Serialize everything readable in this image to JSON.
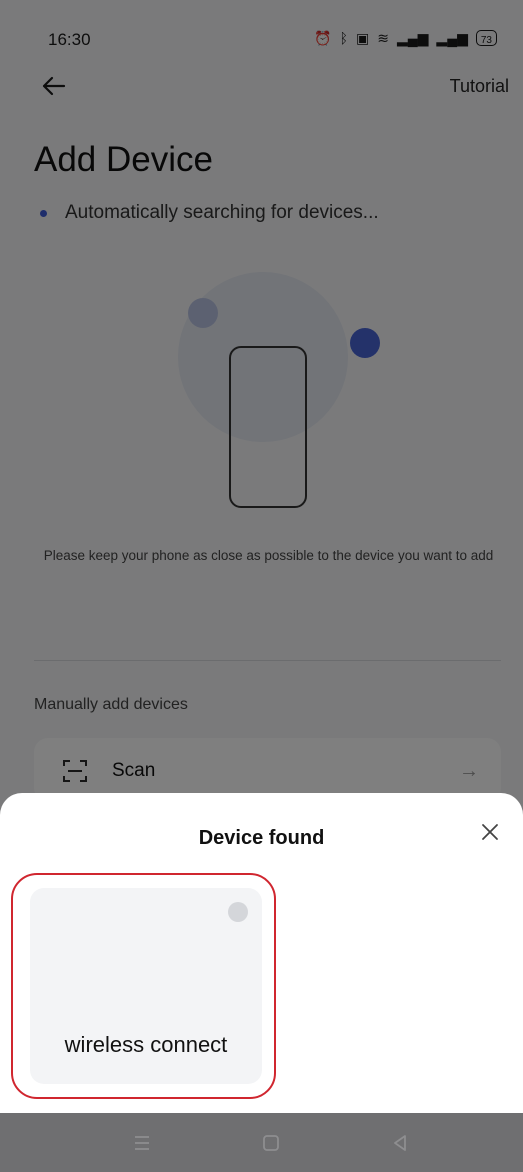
{
  "status_bar": {
    "time": "16:30",
    "battery": "73"
  },
  "header": {
    "tutorial_label": "Tutorial"
  },
  "page": {
    "title": "Add Device",
    "searching_text": "Automatically searching for devices...",
    "hint_text": "Please keep your phone as close as possible to the device you want to add",
    "manual_section_label": "Manually add devices",
    "scan_label": "Scan"
  },
  "sheet": {
    "title": "Device found",
    "devices": [
      {
        "label": "wireless connect"
      }
    ]
  },
  "colors": {
    "accent": "#4864d4",
    "highlight_outline": "#d0262f",
    "scrim": "rgba(0,0,0,0.5)"
  },
  "icons": {
    "back": "arrow-left-icon",
    "close": "close-icon",
    "scan": "scan-frame-icon",
    "scan_arrow": "arrow-right-icon",
    "nav_menu": "menu-icon",
    "nav_home": "home-square-icon",
    "nav_back": "back-triangle-icon"
  }
}
